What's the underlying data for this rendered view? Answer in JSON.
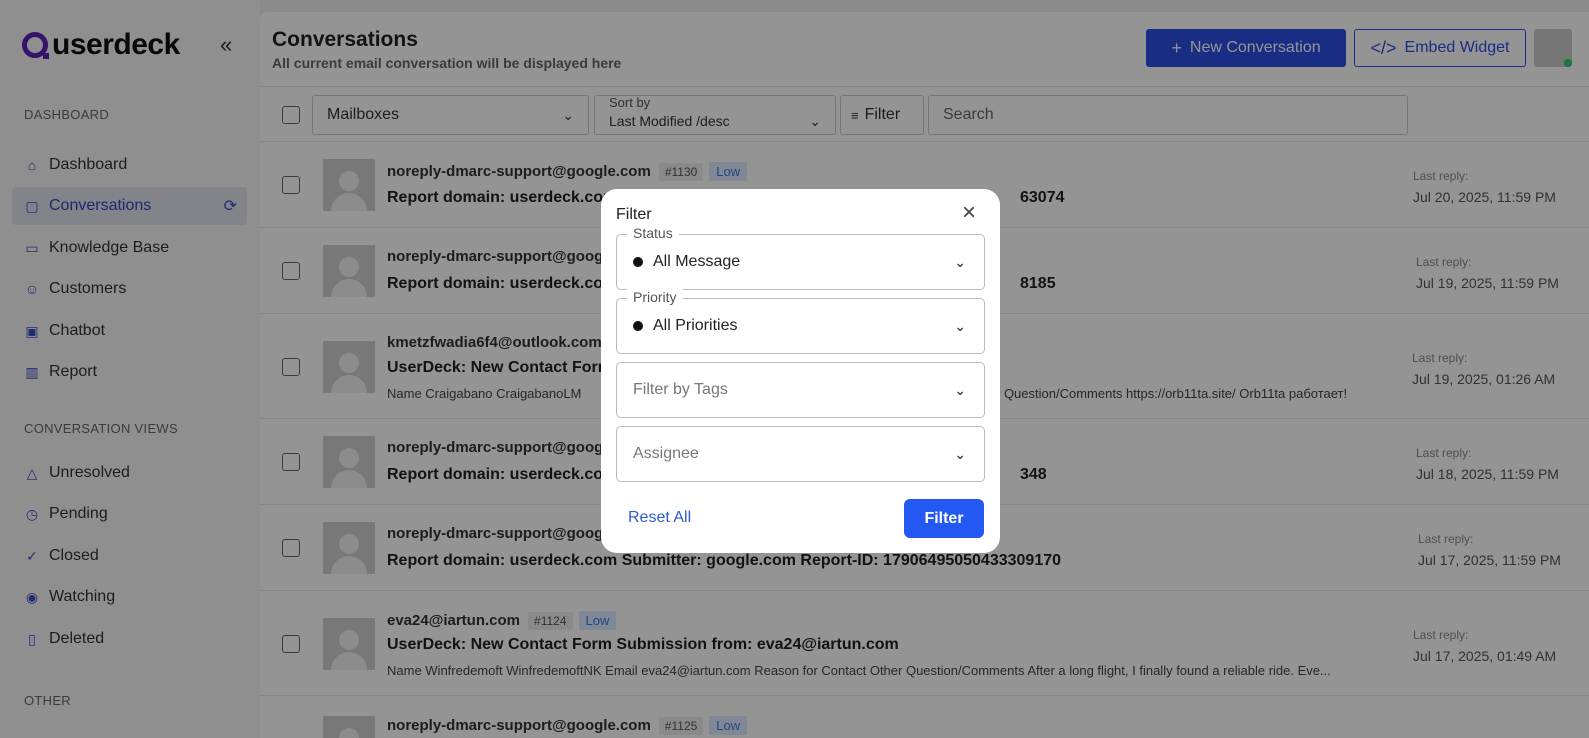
{
  "brand": {
    "logo_text": "userdeck"
  },
  "sidebar": {
    "dashboard_section": "DASHBOARD",
    "items": [
      {
        "label": "Dashboard",
        "icon": "home-icon"
      },
      {
        "label": "Conversations",
        "icon": "chat-icon",
        "active": true
      },
      {
        "label": "Knowledge Base",
        "icon": "book-icon"
      },
      {
        "label": "Customers",
        "icon": "users-icon"
      },
      {
        "label": "Chatbot",
        "icon": "bot-icon"
      },
      {
        "label": "Report",
        "icon": "bar-chart-icon"
      }
    ],
    "views_section": "CONVERSATION VIEWS",
    "views": [
      {
        "label": "Unresolved",
        "icon": "warning-icon"
      },
      {
        "label": "Pending",
        "icon": "clock-icon"
      },
      {
        "label": "Closed",
        "icon": "check-circle-icon"
      },
      {
        "label": "Watching",
        "icon": "eye-icon"
      },
      {
        "label": "Deleted",
        "icon": "trash-icon"
      }
    ],
    "other_section": "OTHER"
  },
  "header": {
    "title": "Conversations",
    "subtitle": "All current email conversation will be displayed here",
    "new_conversation": "New Conversation",
    "embed_widget": "Embed Widget"
  },
  "toolbar": {
    "mailboxes": "Mailboxes",
    "sort_label": "Sort by",
    "sort_value": "Last Modified /desc",
    "filter": "Filter",
    "search_placeholder": "Search"
  },
  "conversations": [
    {
      "from": "noreply-dmarc-support@google.com",
      "id": "#1130",
      "priority": "Low",
      "subject": "Report domain: userdeck.com",
      "subject_tail": "63074",
      "preview": "",
      "reply_label": "Last reply:",
      "reply_date": "Jul 20, 2025, 11:59 PM"
    },
    {
      "from": "noreply-dmarc-support@goog",
      "id": "",
      "priority": "",
      "subject": "Report domain: userdeck.com",
      "subject_tail": "8185",
      "preview": "",
      "reply_label": "Last reply:",
      "reply_date": "Jul 19, 2025, 11:59 PM"
    },
    {
      "from": "kmetzfwadia6f4@outlook.com",
      "id": "",
      "priority": "",
      "subject": "UserDeck: New Contact Form",
      "subject_tail": "",
      "preview": "Name   Craigabano CraigabanoLM",
      "preview_tail": "r Question/Comments   https://orb11ta.site/ Orb11ta работает!",
      "reply_label": "Last reply:",
      "reply_date": "Jul 19, 2025, 01:26 AM"
    },
    {
      "from": "noreply-dmarc-support@goog",
      "id": "",
      "priority": "",
      "subject": "Report domain: userdeck.com",
      "subject_tail": "348",
      "preview": "",
      "reply_label": "Last reply:",
      "reply_date": "Jul 18, 2025, 11:59 PM"
    },
    {
      "from": "noreply-dmarc-support@goog",
      "id": "",
      "priority": "",
      "subject": "Report domain: userdeck.com Submitter: google.com Report-ID: 17906495050433309170",
      "subject_tail": "",
      "preview": "",
      "reply_label": "Last reply:",
      "reply_date": "Jul 17, 2025, 11:59 PM"
    },
    {
      "from": "eva24@iartun.com",
      "id": "#1124",
      "priority": "Low",
      "subject": "UserDeck: New Contact Form Submission from: eva24@iartun.com",
      "subject_tail": "",
      "preview": "Name   Winfredemoft WinfredemoftNK Email   eva24@iartun.com Reason for Contact   Other Question/Comments   After a long flight, I finally found a reliable ride. Eve...",
      "reply_label": "Last reply:",
      "reply_date": "Jul 17, 2025, 01:49 AM"
    },
    {
      "from": "noreply-dmarc-support@google.com",
      "id": "#1125",
      "priority": "Low",
      "subject": "",
      "subject_tail": "",
      "preview": "",
      "reply_label": "",
      "reply_date": ""
    }
  ],
  "modal": {
    "title": "Filter",
    "status_label": "Status",
    "status_value": "All Message",
    "priority_label": "Priority",
    "priority_value": "All Priorities",
    "tags_placeholder": "Filter by Tags",
    "assignee_placeholder": "Assignee",
    "reset": "Reset All",
    "apply": "Filter"
  },
  "colors": {
    "accent": "#2d4fe6",
    "brand": "#5b21b6",
    "badge_low": "#dbeaff",
    "online": "#2ecc71"
  }
}
